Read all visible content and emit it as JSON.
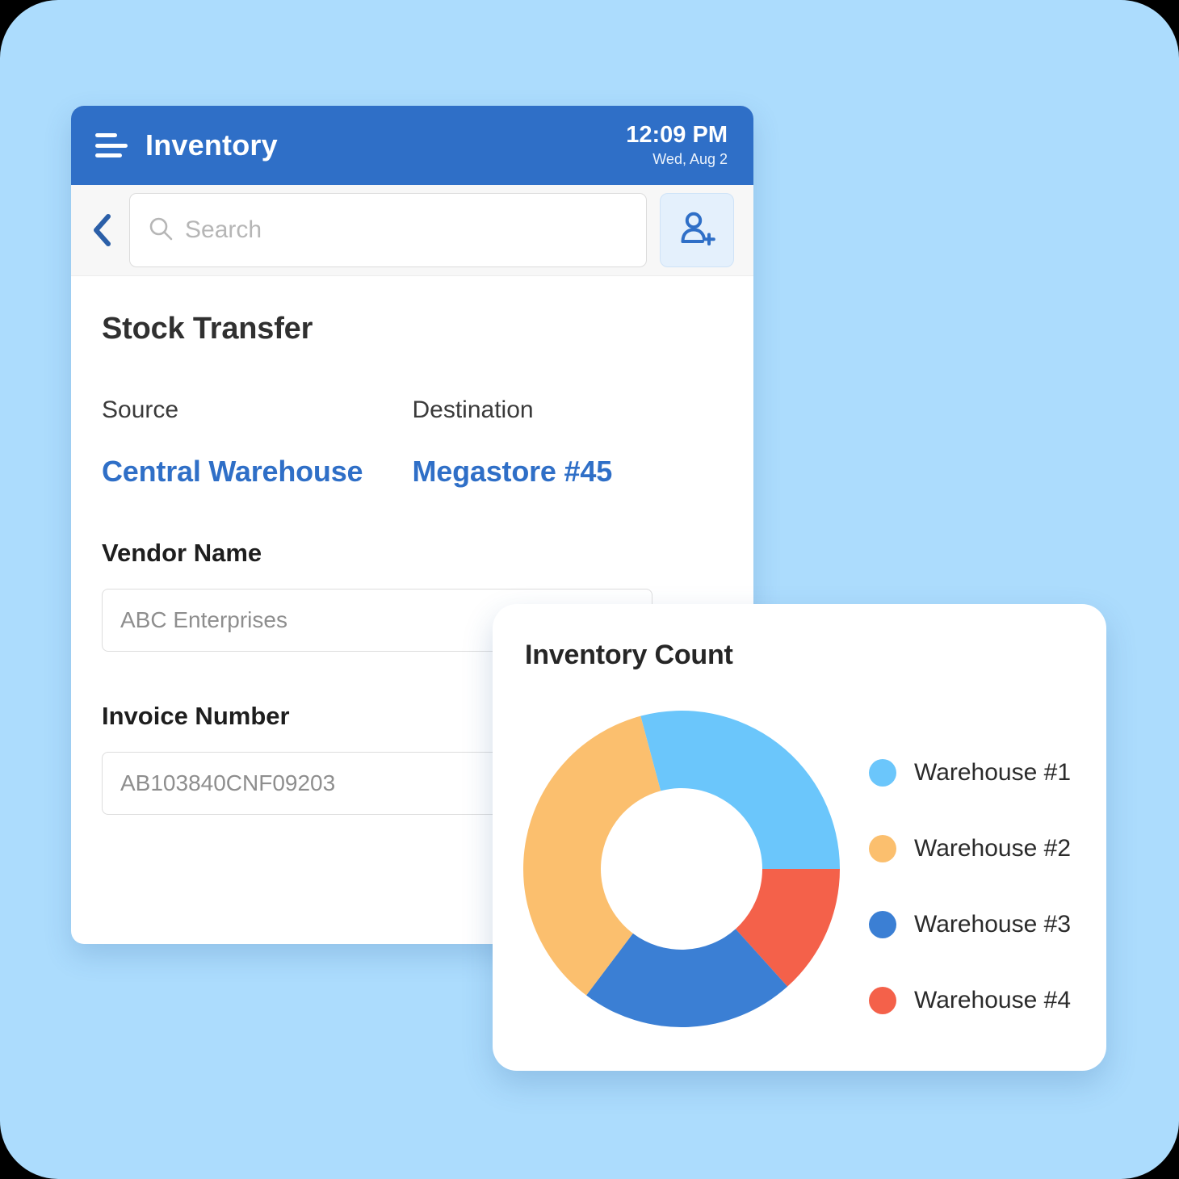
{
  "app": {
    "title": "Inventory",
    "time": "12:09 PM",
    "date": "Wed, Aug 2",
    "menu_icon": "hamburger-icon"
  },
  "toolbar": {
    "back_icon": "chevron-left-icon",
    "search_icon": "search-icon",
    "search_value": "",
    "search_placeholder": "Search",
    "add_user_icon": "add-user-icon"
  },
  "form": {
    "section_title": "Stock Transfer",
    "source_label": "Source",
    "source_value": "Central Warehouse",
    "destination_label": "Destination",
    "destination_value": "Megastore #45",
    "vendor_label": "Vendor Name",
    "vendor_value": "ABC Enterprises",
    "invoice_label": "Invoice Number",
    "invoice_value": "AB103840CNF09203"
  },
  "chart_card": {
    "title": "Inventory Count"
  },
  "colors": {
    "page_background": "#ACDCFD",
    "app_bar": "#2F6FC7",
    "accent_link": "#2F6FC7",
    "warehouse_1": "#6BC6FB",
    "warehouse_2": "#FBBF6E",
    "warehouse_3": "#3B7FD4",
    "warehouse_4": "#F4614A"
  },
  "chart_data": {
    "type": "pie",
    "title": "Inventory Count",
    "variant": "donut",
    "legend_position": "right",
    "categories": [
      "Warehouse #1",
      "Warehouse #2",
      "Warehouse #3",
      "Warehouse #4"
    ],
    "values": [
      29,
      36,
      22,
      13
    ],
    "unit": "%",
    "colors": [
      "#6BC6FB",
      "#FBBF6E",
      "#3B7FD4",
      "#F4614A"
    ],
    "slices": [
      {
        "label": "Warehouse #1",
        "value": 29,
        "color": "#6BC6FB",
        "start_angle": 345,
        "end_angle": 90
      },
      {
        "label": "Warehouse #4",
        "value": 13,
        "color": "#F4614A",
        "start_angle": 90,
        "end_angle": 138
      },
      {
        "label": "Warehouse #3",
        "value": 22,
        "color": "#3B7FD4",
        "start_angle": 138,
        "end_angle": 217
      },
      {
        "label": "Warehouse #2",
        "value": 36,
        "color": "#FBBF6E",
        "start_angle": 217,
        "end_angle": 345
      }
    ]
  }
}
